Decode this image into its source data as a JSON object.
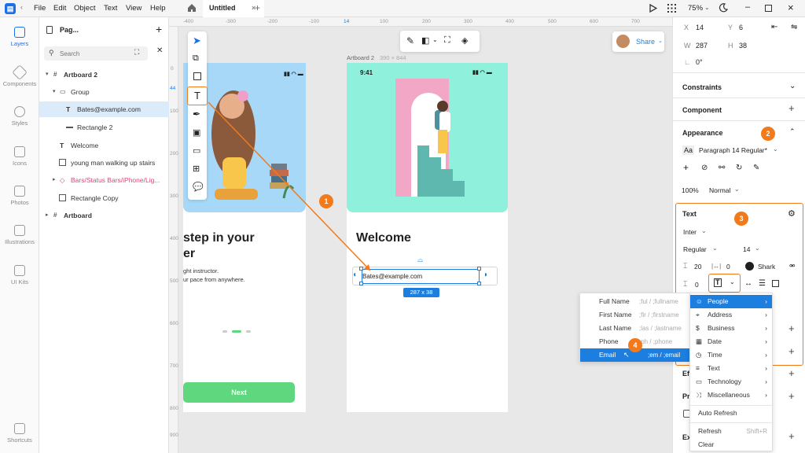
{
  "menu": [
    "File",
    "Edit",
    "Object",
    "Text",
    "View",
    "Help"
  ],
  "tab": {
    "title": "Untitled",
    "close": "×",
    "add": "+"
  },
  "topbar": {
    "zoom": "75%"
  },
  "rail": [
    {
      "label": "Layers",
      "icon": "layers-icon"
    },
    {
      "label": "Components",
      "icon": "components-icon"
    },
    {
      "label": "Styles",
      "icon": "styles-icon"
    },
    {
      "label": "Icons",
      "icon": "icons-icon"
    },
    {
      "label": "Photos",
      "icon": "photos-icon"
    },
    {
      "label": "Illustrations",
      "icon": "illustrations-icon"
    },
    {
      "label": "UI Kits",
      "icon": "uikits-icon"
    },
    {
      "label": "Shortcuts",
      "icon": "shortcuts-icon"
    }
  ],
  "layers": {
    "page": "Pag...",
    "search_placeholder": "Search",
    "items": [
      {
        "label": "Artboard 2",
        "depth": 0,
        "kind": "artboard"
      },
      {
        "label": "Group",
        "depth": 1,
        "kind": "group"
      },
      {
        "label": "Bates@example.com",
        "depth": 2,
        "kind": "text",
        "selected": true
      },
      {
        "label": "Rectangle 2",
        "depth": 2,
        "kind": "rect"
      },
      {
        "label": "Welcome",
        "depth": 1,
        "kind": "text"
      },
      {
        "label": "young man walking up stairs",
        "depth": 1,
        "kind": "image"
      },
      {
        "label": "Bars/Status Bars/iPhone/Lig...",
        "depth": 1,
        "kind": "component"
      },
      {
        "label": "Rectangle Copy",
        "depth": 1,
        "kind": "rect"
      },
      {
        "label": "Artboard",
        "depth": 0,
        "kind": "artboard"
      }
    ]
  },
  "canvas": {
    "ruler_h": [
      "-400",
      "-300",
      "-200",
      "-100",
      "14",
      "100",
      "200",
      "300",
      "400",
      "500",
      "600",
      "700"
    ],
    "ruler_v": [
      "0",
      "44",
      "100",
      "200",
      "300",
      "400",
      "500",
      "600",
      "700",
      "800",
      "900"
    ],
    "artboard_label": "Artboard 2",
    "artboard_size": "390 × 844",
    "time": "9:41",
    "left_heading_1": "step in your",
    "left_heading_2": "er",
    "left_sub_1": "ght instructor.",
    "left_sub_2": "ur pace from anywhere.",
    "next_button": "Next",
    "welcome": "Welcome",
    "email_text": "Bates@example.com",
    "size_label": "287 x 38",
    "share": "Share"
  },
  "right": {
    "x": "14",
    "y": "6",
    "w": "287",
    "h": "38",
    "angle": "0°",
    "x_label": "X",
    "y_label": "Y",
    "w_label": "W",
    "h_label": "H",
    "constraints": "Constraints",
    "component": "Component",
    "appearance": "Appearance",
    "paragraph": "Paragraph 14 Regular*",
    "opacity": "100%",
    "blend": "Normal",
    "text_title": "Text",
    "font": "Inter",
    "weight": "Regular",
    "size": "14",
    "line_height": "20",
    "letter_spacing": "0",
    "color_name": "Shark",
    "para_spacing": "0",
    "eff": "Eff",
    "pro": "Pro",
    "exp": "Exp",
    "auto_refresh": "Auto Refresh",
    "refresh": "Refresh",
    "refresh_shortcut": "Shift+R",
    "clear": "Clear"
  },
  "badges": [
    "1",
    "2",
    "3",
    "4"
  ],
  "people_menu": [
    {
      "label": "Full Name",
      "placeholder": ";ful / ;fullname"
    },
    {
      "label": "First Name",
      "placeholder": ";fir / ;firstname"
    },
    {
      "label": "Last Name",
      "placeholder": ";las / ;lastname"
    },
    {
      "label": "Phone",
      "placeholder": ";ph / ;phone"
    },
    {
      "label": "Email",
      "placeholder": ";em / ;email",
      "highlighted": true
    }
  ],
  "category_menu": [
    {
      "label": "People",
      "highlighted": true
    },
    {
      "label": "Address"
    },
    {
      "label": "Business"
    },
    {
      "label": "Date"
    },
    {
      "label": "Time"
    },
    {
      "label": "Text"
    },
    {
      "label": "Technology"
    },
    {
      "label": "Miscellaneous"
    }
  ],
  "colors": {
    "accent": "#1c7fe0",
    "badge": "#f27a1a",
    "mint": "#8ff0dc",
    "sky": "#a7d8f7",
    "green": "#5fd77f"
  }
}
